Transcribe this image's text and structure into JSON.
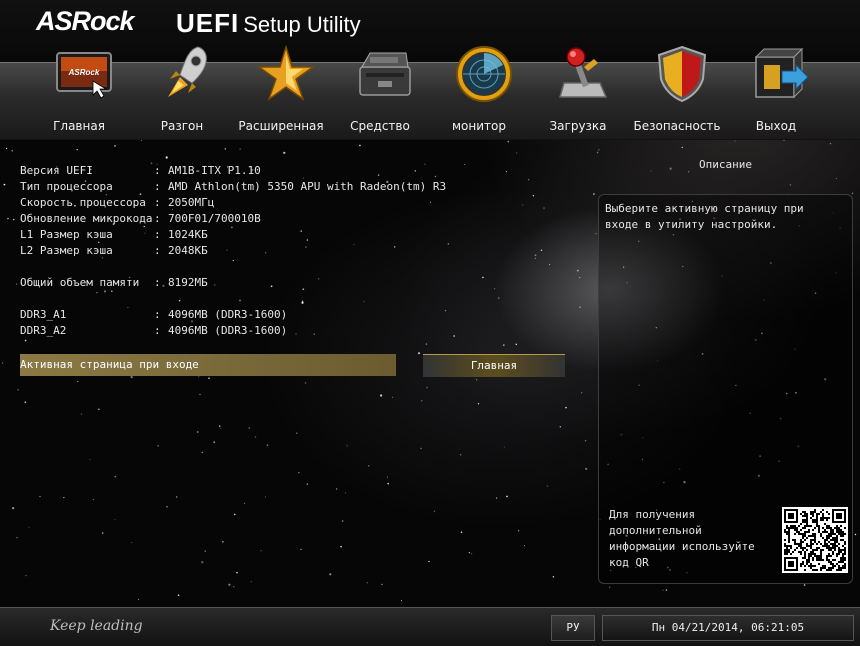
{
  "header": {
    "logo": "ASRock",
    "title_uefi": "UEFI",
    "title_rest": "Setup Utility"
  },
  "nav": [
    {
      "label": "Главная",
      "icon": "monitor-home-icon",
      "active": true
    },
    {
      "label": "Разгон",
      "icon": "rocket-icon"
    },
    {
      "label": "Расширенная",
      "icon": "star-icon"
    },
    {
      "label": "Средство",
      "icon": "toolbox-icon"
    },
    {
      "label": "монитор",
      "icon": "radar-icon"
    },
    {
      "label": "Загрузка",
      "icon": "joystick-icon"
    },
    {
      "label": "Безопасность",
      "icon": "shield-icon"
    },
    {
      "label": "Выход",
      "icon": "exit-box-icon"
    }
  ],
  "info": [
    {
      "key": "Версия UEFI",
      "value": "AM1B-ITX P1.10"
    },
    {
      "key": "Тип процессора",
      "value": "AMD Athlon(tm) 5350 APU with Radeon(tm) R3"
    },
    {
      "key": "Скорость процессора",
      "value": "2050МГц"
    },
    {
      "key": "Обновление микрокода",
      "value": "700F01/700010B"
    },
    {
      "key": "L1 Размер кэша",
      "value": "1024КБ"
    },
    {
      "key": "L2 Размер кэша",
      "value": "2048КБ"
    },
    {
      "key": "Общий объем памяти",
      "value": "8192МБ"
    },
    {
      "key": "DDR3_A1",
      "value": "4096MB (DDR3-1600)"
    },
    {
      "key": "DDR3_A2",
      "value": "4096MB (DDR3-1600)"
    }
  ],
  "active_page": {
    "label": "Активная страница при входе",
    "value": "Главная"
  },
  "description": {
    "title": "Описание",
    "text": "Выберите активную страницу при входе в утилиту настройки.",
    "qr_text": "Для получения дополнительной информации используйте код QR"
  },
  "footer": {
    "tagline": "Keep leading",
    "language": "РУ",
    "datetime": "Пн 04/21/2014, 06:21:05"
  },
  "colors": {
    "highlight_gold": "#8b7a45",
    "background": "#060606"
  }
}
